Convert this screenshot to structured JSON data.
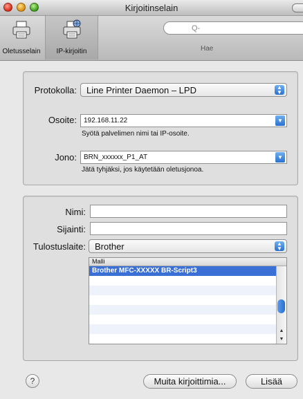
{
  "window": {
    "title": "Kirjoitinselain"
  },
  "toolbar": {
    "default_label": "Oletusselain",
    "ip_label": "IP-kirjoitin",
    "search_placeholder": "Q-",
    "search_label": "Hae"
  },
  "connection": {
    "protocol_label": "Protokolla:",
    "protocol_value": "Line Printer Daemon – LPD",
    "address_label": "Osoite:",
    "address_value": "192.168.11.22",
    "address_hint": "Syötä palvelimen nimi tai IP-osoite.",
    "queue_label": "Jono:",
    "queue_value": "BRN_xxxxxx_P1_AT",
    "queue_hint": "Jätä tyhjäksi, jos käytetään oletusjonoa."
  },
  "printer": {
    "name_label": "Nimi:",
    "name_value": "",
    "location_label": "Sijainti:",
    "location_value": "",
    "print_using_label": "Tulostuslaite:",
    "print_using_value": "Brother",
    "model_header": "Malli",
    "models": [
      "Brother MFC-XXXXX BR-Script3"
    ]
  },
  "buttons": {
    "help": "?",
    "more_printers": "Muita kirjoittimia...",
    "add": "Lisää"
  },
  "colors": {
    "selection": "#3a6fd6",
    "accent": "#2a70d0"
  }
}
